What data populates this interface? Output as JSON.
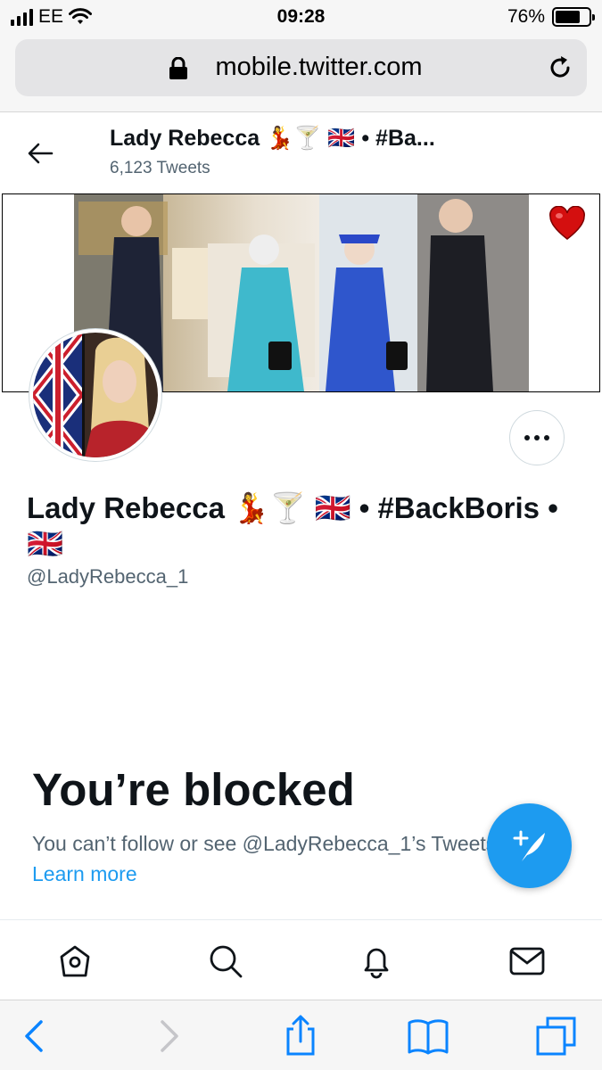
{
  "status_bar": {
    "carrier": "EE",
    "time": "09:28",
    "battery_percent": "76%",
    "battery_level": 0.76
  },
  "browser": {
    "url": "mobile.twitter.com"
  },
  "header": {
    "name": "Lady Rebecca 💃🍸 🇬🇧 • #Ba...",
    "tweet_count": "6,123 Tweets"
  },
  "profile": {
    "display_name": "Lady Rebecca 💃🍸 🇬🇧 • #BackBoris • 🇬🇧",
    "handle": "@LadyRebecca_1"
  },
  "blocked": {
    "title": "You’re blocked",
    "message": "You can’t follow or see @LadyRebecca_1’s Tweets.",
    "learn_more": "Learn more"
  },
  "colors": {
    "accent": "#1d9bf0",
    "text_primary": "#0f1419",
    "text_secondary": "#536471",
    "ios_blue": "#0a84ff"
  },
  "icons": {
    "bottom_nav": [
      "home-icon",
      "search-icon",
      "notifications-icon",
      "messages-icon"
    ],
    "safari_toolbar": [
      "back-icon",
      "forward-icon",
      "share-icon",
      "bookmarks-icon",
      "tabs-icon"
    ]
  }
}
